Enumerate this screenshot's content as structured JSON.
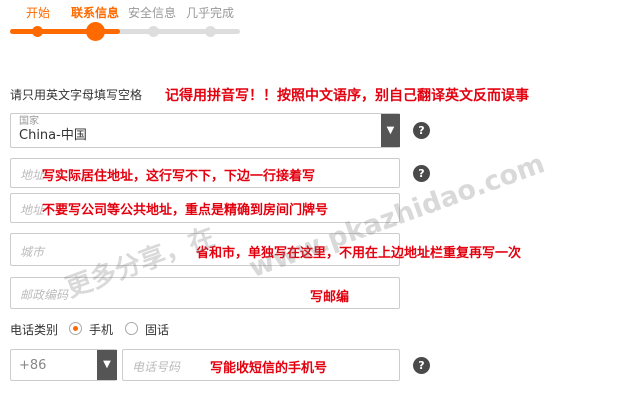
{
  "stepper": {
    "steps": [
      {
        "label": "开始",
        "state": "done"
      },
      {
        "label": "联系信息",
        "state": "current"
      },
      {
        "label": "安全信息",
        "state": "todo"
      },
      {
        "label": "几乎完成",
        "state": "todo"
      }
    ],
    "active_color": "#ff6a00",
    "inactive_color": "#dddddd"
  },
  "instruction": "请只用英文字母填写空格",
  "annotations": {
    "pinyin": "记得用拼音写！！按照中文语序，别自己翻译英文反而误事",
    "address1": "写实际居住地址，这行写不下，下边一行接着写",
    "address2": "不要写公司等公共地址，重点是精确到房间门牌号",
    "city": "省和市，单独写在这里，不用在上边地址栏重复再写一次",
    "zip": "写邮编",
    "phone": "写能收短信的手机号"
  },
  "country": {
    "label": "国家",
    "value": "China-中国",
    "dropdown_icon": "chevron-down-icon"
  },
  "address_line1": {
    "placeholder": "地址"
  },
  "address_line2": {
    "placeholder": "地址"
  },
  "city": {
    "placeholder": "城市"
  },
  "zip": {
    "placeholder": "邮政编码"
  },
  "phone_type": {
    "label": "电话类别",
    "options": [
      "手机",
      "固话"
    ],
    "selected": "手机"
  },
  "phone": {
    "country_code": "+86",
    "placeholder": "电话号码"
  },
  "help_icon": "?",
  "watermark": {
    "line1": "更多分享，在",
    "line2": "www.pkazhidao.com"
  }
}
